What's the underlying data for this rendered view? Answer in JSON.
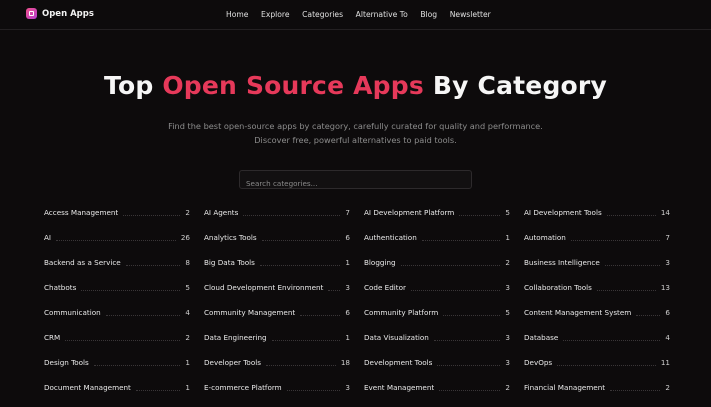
{
  "header": {
    "brand": "Open Apps",
    "nav": [
      "Home",
      "Explore",
      "Categories",
      "Alternative To",
      "Blog",
      "Newsletter"
    ]
  },
  "hero": {
    "title_prefix": "Top ",
    "title_accent": "Open Source Apps",
    "title_suffix": " By Category",
    "subtitle_line1": "Find the best open-source apps by category, carefully curated for quality and performance.",
    "subtitle_line2": "Discover free, powerful alternatives to paid tools."
  },
  "search": {
    "placeholder": "Search categories..."
  },
  "colors": {
    "accent": "#e6395a",
    "background": "#0d0b0c"
  },
  "categories": [
    {
      "name": "Access Management",
      "count": "2"
    },
    {
      "name": "AI Agents",
      "count": "7"
    },
    {
      "name": "AI Development Platform",
      "count": "5"
    },
    {
      "name": "AI Development Tools",
      "count": "14"
    },
    {
      "name": "AI",
      "count": "26"
    },
    {
      "name": "Analytics Tools",
      "count": "6"
    },
    {
      "name": "Authentication",
      "count": "1"
    },
    {
      "name": "Automation",
      "count": "7"
    },
    {
      "name": "Backend as a Service",
      "count": "8"
    },
    {
      "name": "Big Data Tools",
      "count": "1"
    },
    {
      "name": "Blogging",
      "count": "2"
    },
    {
      "name": "Business Intelligence",
      "count": "3"
    },
    {
      "name": "Chatbots",
      "count": "5"
    },
    {
      "name": "Cloud Development Environment",
      "count": "3"
    },
    {
      "name": "Code Editor",
      "count": "3"
    },
    {
      "name": "Collaboration Tools",
      "count": "13"
    },
    {
      "name": "Communication",
      "count": "4"
    },
    {
      "name": "Community Management",
      "count": "6"
    },
    {
      "name": "Community Platform",
      "count": "5"
    },
    {
      "name": "Content Management System",
      "count": "6"
    },
    {
      "name": "CRM",
      "count": "2"
    },
    {
      "name": "Data Engineering",
      "count": "1"
    },
    {
      "name": "Data Visualization",
      "count": "3"
    },
    {
      "name": "Database",
      "count": "4"
    },
    {
      "name": "Design Tools",
      "count": "1"
    },
    {
      "name": "Developer Tools",
      "count": "18"
    },
    {
      "name": "Development Tools",
      "count": "3"
    },
    {
      "name": "DevOps",
      "count": "11"
    },
    {
      "name": "Document Management",
      "count": "1"
    },
    {
      "name": "E-commerce Platform",
      "count": "3"
    },
    {
      "name": "Event Management",
      "count": "2"
    },
    {
      "name": "Financial Management",
      "count": "2"
    }
  ]
}
